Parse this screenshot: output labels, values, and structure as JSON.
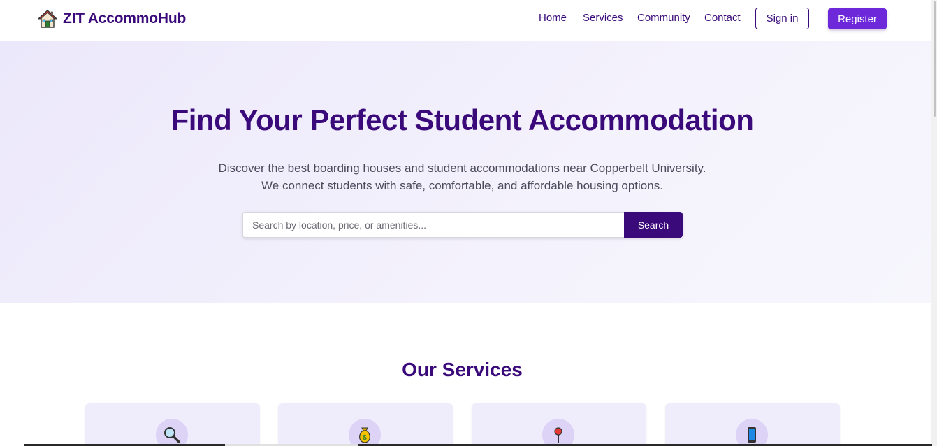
{
  "brand": {
    "name": "ZIT AccommoHub",
    "icon": "house-icon"
  },
  "nav": {
    "links": [
      {
        "label": "Home"
      },
      {
        "label": "Services"
      },
      {
        "label": "Community"
      },
      {
        "label": "Contact"
      }
    ],
    "signin_label": "Sign in",
    "register_label": "Register"
  },
  "hero": {
    "title": "Find Your Perfect Student Accommodation",
    "subtitle_line1": "Discover the best boarding houses and student accommodations near Copperbelt University.",
    "subtitle_line2": "We connect students with safe, comfortable, and affordable housing options.",
    "search_placeholder": "Search by location, price, or amenities...",
    "search_value": "",
    "search_button": "Search"
  },
  "services": {
    "title": "Our Services",
    "cards": [
      {
        "icon": "magnifier-icon"
      },
      {
        "icon": "money-bag-icon"
      },
      {
        "icon": "pushpin-icon"
      },
      {
        "icon": "mobile-phone-icon"
      }
    ]
  },
  "colors": {
    "primary": "#3a0a7a",
    "accent": "#6d28d9",
    "hero_bg": "#ece8fb",
    "card_bg": "#efecfb"
  }
}
